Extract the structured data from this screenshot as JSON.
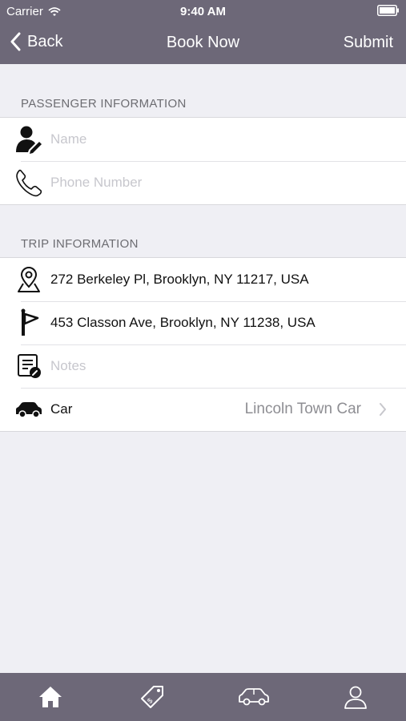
{
  "status_bar": {
    "carrier": "Carrier",
    "time": "9:40 AM"
  },
  "nav": {
    "back_label": "Back",
    "title": "Book Now",
    "submit_label": "Submit"
  },
  "passenger": {
    "header": "PASSENGER INFORMATION",
    "name_placeholder": "Name",
    "phone_placeholder": "Phone Number"
  },
  "trip": {
    "header": "TRIP INFORMATION",
    "pickup": "272 Berkeley Pl, Brooklyn, NY 11217, USA",
    "destination": "453 Classon Ave, Brooklyn, NY 11238, USA",
    "notes_placeholder": "Notes",
    "car_label": "Car",
    "car_value": "Lincoln Town Car"
  },
  "tabbar": {
    "tabs": [
      {
        "icon": "home-icon",
        "selected": true
      },
      {
        "icon": "tag-icon",
        "selected": false
      },
      {
        "icon": "car-icon",
        "selected": false
      },
      {
        "icon": "user-icon",
        "selected": false
      }
    ]
  },
  "colors": {
    "bar": "#6d6878",
    "background": "#efeff4",
    "placeholder": "#c7c7cd"
  }
}
